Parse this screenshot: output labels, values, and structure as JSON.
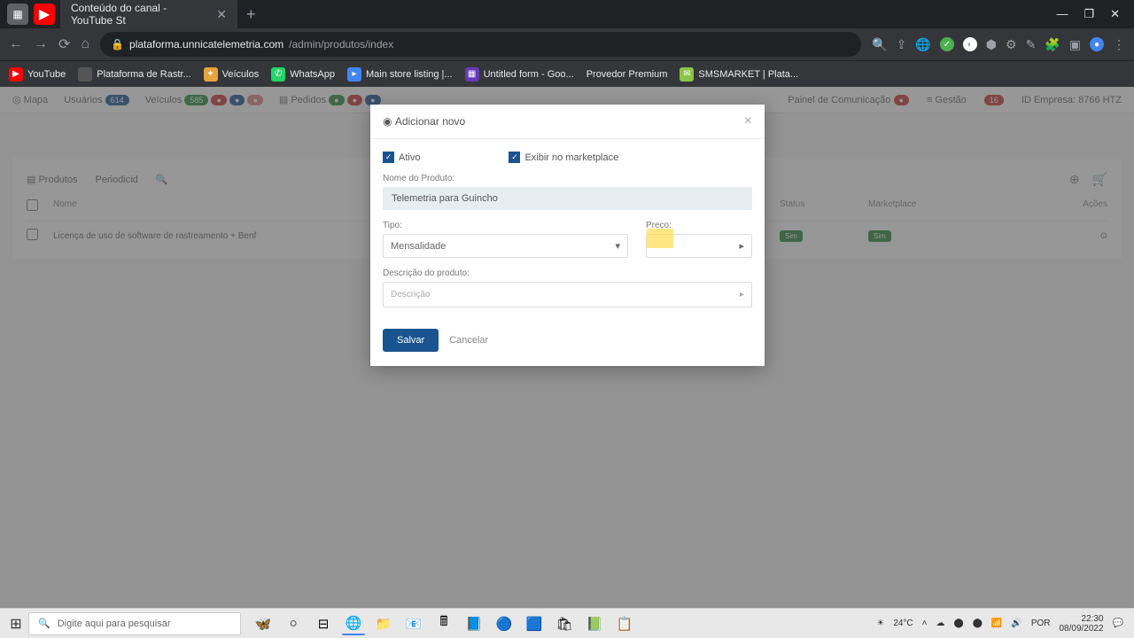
{
  "browser": {
    "tab_title": "Conteúdo do canal - YouTube St",
    "url_prefix": "plataforma.unnicatelemetria.com",
    "url_path": "/admin/produtos/index",
    "win_min": "—",
    "win_max": "❐",
    "win_close": "✕"
  },
  "bookmarks": [
    {
      "label": "YouTube",
      "color": "#f00"
    },
    {
      "label": "Plataforma de Rastr...",
      "color": "#555"
    },
    {
      "label": "Veículos",
      "color": "#e8a33d"
    },
    {
      "label": "WhatsApp",
      "color": "#25d366"
    },
    {
      "label": "Main store listing |...",
      "color": "#4285f4"
    },
    {
      "label": "Untitled form - Goo...",
      "color": "#673ab7"
    },
    {
      "label": "Provedor Premium",
      "color": "#555"
    },
    {
      "label": "SMSMARKET | Plata...",
      "color": "#8bc34a"
    }
  ],
  "topnav": {
    "mapa": "Mapa",
    "usuarios": "Usuários",
    "usuarios_badge": "614",
    "veiculos": "Veículos",
    "veiculos_b1": "585",
    "pedidos": "Pedidos",
    "painel": "Painel de Comunicação",
    "gestao": "Gestão",
    "empresa": "ID Empresa: 8766 HTZ"
  },
  "panel": {
    "tab1": "Produtos",
    "tab2": "Periodicid",
    "col_name": "Nome",
    "col_status": "Status",
    "col_mkt": "Marketplace",
    "col_act": "Ações",
    "row1_name": "Licença de uso de software de rastreamento + Benf",
    "row1_status": "Sim",
    "row1_mkt": "Sim"
  },
  "modal": {
    "title": "Adicionar novo",
    "chk_ativo": "Ativo",
    "chk_exibir": "Exibir no marketplace",
    "lbl_nome": "Nome do Produto:",
    "val_nome": "Telemetria para Guincho",
    "lbl_tipo": "Tipo:",
    "val_tipo": "Mensalidade",
    "lbl_preco": "Preço:",
    "val_preco": "",
    "lbl_desc": "Descrição do produto:",
    "ph_desc": "Descrição",
    "btn_save": "Salvar",
    "btn_cancel": "Cancelar"
  },
  "taskbar": {
    "search_ph": "Digite aqui para pesquisar",
    "temp": "24°C",
    "time": "22:30",
    "date": "08/09/2022"
  }
}
